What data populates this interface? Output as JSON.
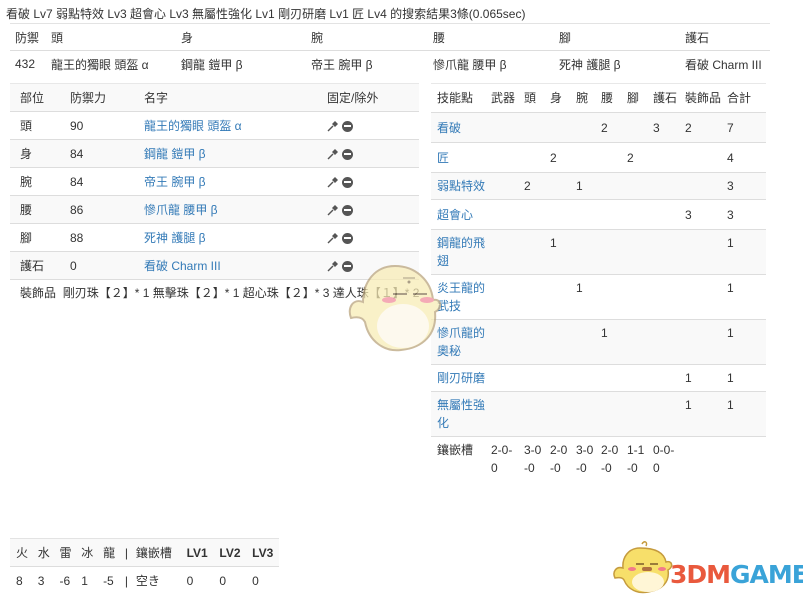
{
  "result_title": "看破 Lv7 弱點特效 Lv3 超會心 Lv3 無屬性強化 Lv1 剛刃研磨 Lv1 匠 Lv4 的搜索結果3條(0.065sec)",
  "summary": {
    "headers": [
      "防禦",
      "頭",
      "身",
      "腕",
      "腰",
      "腳",
      "護石"
    ],
    "row": [
      "432",
      "龍王的獨眼 頭盔 α",
      "鋼龍 鎧甲 β",
      "帝王 腕甲 β",
      "慘爪龍 腰甲 β",
      "死神 護腿 β",
      "看破 Charm III"
    ]
  },
  "armor_table": {
    "headers": [
      "部位",
      "防禦力",
      "名字",
      "固定/除外"
    ],
    "rows": [
      {
        "slot": "頭",
        "defense": "90",
        "name": "龍王的獨眼 頭盔 α"
      },
      {
        "slot": "身",
        "defense": "84",
        "name": "鋼龍 鎧甲 β"
      },
      {
        "slot": "腕",
        "defense": "84",
        "name": "帝王 腕甲 β"
      },
      {
        "slot": "腰",
        "defense": "86",
        "name": "慘爪龍 腰甲 β"
      },
      {
        "slot": "腳",
        "defense": "88",
        "name": "死神 護腿 β"
      },
      {
        "slot": "護石",
        "defense": "0",
        "name": "看破 Charm III"
      }
    ],
    "decorations_label": "裝飾品",
    "decorations": "剛刃珠【２】* 1 無擊珠【２】* 1 超心珠【２】* 3 達人珠【１】* 2",
    "icons": {
      "fix": "pin-icon",
      "exclude": "minus-circle-icon"
    }
  },
  "skill_table": {
    "headers": [
      "技能點",
      "武器",
      "頭",
      "身",
      "腕",
      "腰",
      "腳",
      "護石",
      "裝飾品",
      "合計"
    ],
    "rows": [
      {
        "skill": "看破",
        "cells": [
          "",
          "",
          "",
          "",
          "2",
          "",
          "3",
          "2",
          "7"
        ]
      },
      {
        "skill": "匠",
        "cells": [
          "",
          "",
          "2",
          "",
          "",
          "2",
          "",
          "",
          "4"
        ]
      },
      {
        "skill": "弱點特效",
        "cells": [
          "",
          "2",
          "",
          "1",
          "",
          "",
          "",
          "",
          "3"
        ]
      },
      {
        "skill": "超會心",
        "cells": [
          "",
          "",
          "",
          "",
          "",
          "",
          "",
          "3",
          "3"
        ]
      },
      {
        "skill": "鋼龍的飛翅",
        "cells": [
          "",
          "",
          "1",
          "",
          "",
          "",
          "",
          "",
          "1"
        ]
      },
      {
        "skill": "炎王龍的武技",
        "cells": [
          "",
          "",
          "",
          "1",
          "",
          "",
          "",
          "",
          "1"
        ]
      },
      {
        "skill": "慘爪龍的奧秘",
        "cells": [
          "",
          "",
          "",
          "",
          "1",
          "",
          "",
          "",
          "1"
        ]
      },
      {
        "skill": "剛刃研磨",
        "cells": [
          "",
          "",
          "",
          "",
          "",
          "",
          "",
          "1",
          "1"
        ]
      },
      {
        "skill": "無屬性強化",
        "cells": [
          "",
          "",
          "",
          "",
          "",
          "",
          "",
          "1",
          "1"
        ]
      }
    ],
    "slots_label": "鑲嵌槽",
    "slots": [
      "2-0-0",
      "3-0-0",
      "2-0-0",
      "3-0-0",
      "2-0-0",
      "1-1-0",
      "0-0-0",
      "",
      ""
    ]
  },
  "resist_table": {
    "headers": [
      "火",
      "水",
      "雷",
      "冰",
      "龍",
      "|",
      "鑲嵌槽",
      "LV1",
      "LV2",
      "LV3"
    ],
    "values": [
      "8",
      "3",
      "-6",
      "1",
      "-5",
      "|",
      "空き",
      "0",
      "0",
      "0"
    ]
  },
  "watermark": {
    "logo_a": "3DM",
    "logo_b": "GAME"
  }
}
